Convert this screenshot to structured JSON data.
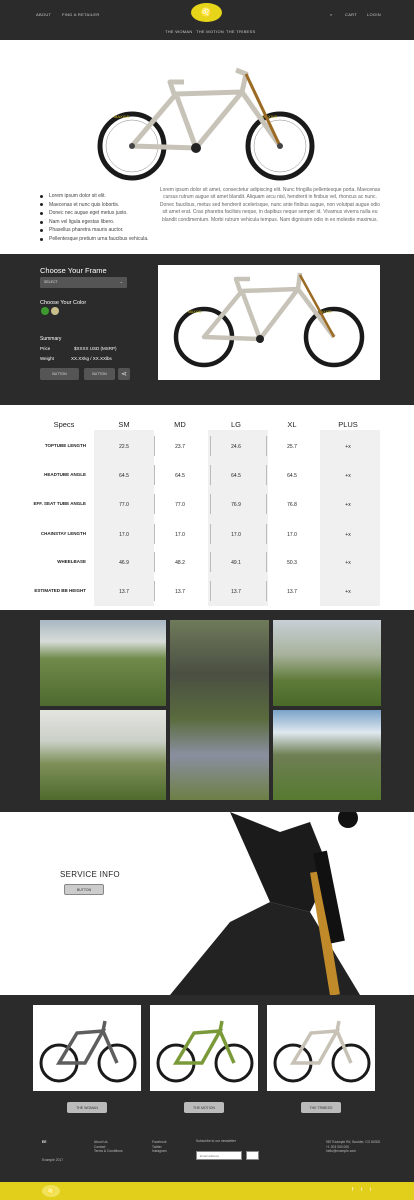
{
  "header": {
    "nav_left": [
      "ABOUT",
      "FIND A RETAILER"
    ],
    "nav_right": [
      "⌕",
      "CART",
      "LOGIN"
    ],
    "sub_nav": [
      "THE WOMAN",
      "THE MOTION",
      "THE TRIBESS"
    ]
  },
  "hero": {
    "bullets": [
      "Lorem ipsum dolor sit elit.",
      "Maecenas et nunc quis lobortis.",
      "Donec nec augue eget metus justo.",
      "Nam vel ligula egestas libero.",
      "Phasellus pharetra mauris auctor.",
      "Pellentesque pretium urna faucibus vehicula."
    ],
    "description": "Lorem ipsum dolor sit amet, consectetur adipiscing elit. Nunc fringilla pellentesque porta. Maecenas cursus rutrum augue sit amet blandit. Aliquam arcu nisl, hendrerit in finibus vel, rhoncus ac nunc. Donec faucibus, metus sed hendrerit scelerisque, nunc ante finibus augue, non volutpat augue odio sit amet erat. Cras pharetra facilisis neque, in dapibus neque semper id. Vivamus viverra nulla eu blandit condimentum. Morbi rutrum vehicula tempus. Nam dignissim odio in ex molestie maximus."
  },
  "config": {
    "frame_title": "Choose Your Frame",
    "frame_select": "SELECT",
    "color_title": "Choose Your Color",
    "swatches": [
      "#3c9a2e",
      "#c8bf8c"
    ],
    "summary_title": "Summary",
    "price_label": "Price",
    "price_value": "$XXXX USD (MSRP)",
    "weight_label": "Weight",
    "weight_value": "XX.XXkg / XX.XXlbs",
    "button1": "BUTTON",
    "button2": "BUTTON",
    "share_icon": "share-icon"
  },
  "specs": {
    "headers": [
      "Specs",
      "SM",
      "MD",
      "LG",
      "XL",
      "PLUS"
    ],
    "rows": [
      {
        "label": "TOPTUBE LENGTH",
        "values": [
          "22.5",
          "23.7",
          "24.6",
          "25.7",
          "+x"
        ]
      },
      {
        "label": "HEADTUBE ANGLE",
        "values": [
          "64.5",
          "64.5",
          "64.5",
          "64.5",
          "+x"
        ]
      },
      {
        "label": "EFF. SEAT TUBE ANGLE",
        "values": [
          "77.0",
          "77.0",
          "76.9",
          "76.8",
          "+x"
        ]
      },
      {
        "label": "CHAINSTAY LENGTH",
        "values": [
          "17.0",
          "17.0",
          "17.0",
          "17.0",
          "+x"
        ]
      },
      {
        "label": "WHEELBASE",
        "values": [
          "46.9",
          "48.2",
          "49.1",
          "50.3",
          "+x"
        ]
      },
      {
        "label": "ESTIMATED BB HEIGHT",
        "values": [
          "13.7",
          "13.7",
          "13.7",
          "13.7",
          "+x"
        ]
      }
    ]
  },
  "service": {
    "title": "SERVICE INFO",
    "button": "BUTTON"
  },
  "cards": {
    "buttons": [
      "THE WOMAN",
      "THE MOTION",
      "THE TRIBESS"
    ],
    "frame_colors": [
      "#5e5e5e",
      "#7a9a3a",
      "#c7c2b5"
    ]
  },
  "footer": {
    "logo_text": "EE",
    "copyright": "Example 2017",
    "col1": [
      "About Us",
      "Contact",
      "Terms & Conditions"
    ],
    "col2": [
      "Facebook",
      "Twitter",
      "Instagram"
    ],
    "newsletter_label": "Subscribe to our newsletter",
    "email_placeholder": "Email address",
    "address": [
      "987 Example Rd, Boulder, CO 80302",
      "+1 303 000 000",
      "hello@example.com"
    ],
    "social": [
      "f",
      "t",
      "i"
    ]
  }
}
